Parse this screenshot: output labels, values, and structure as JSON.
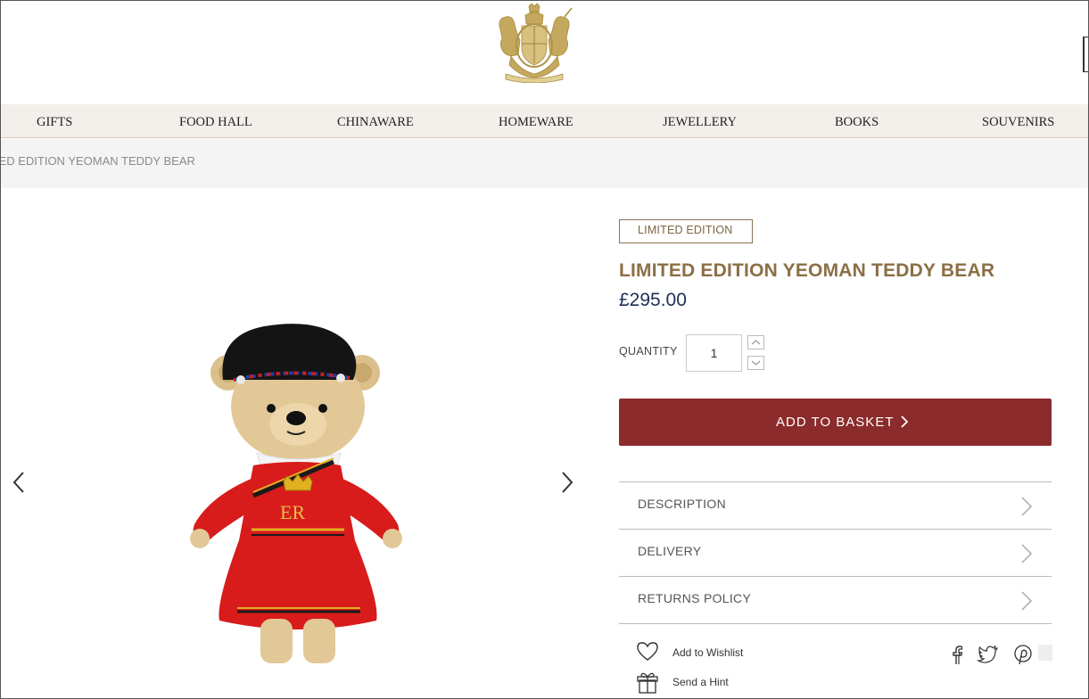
{
  "nav": {
    "items": [
      {
        "label": "GIFTS"
      },
      {
        "label": "FOOD HALL"
      },
      {
        "label": "CHINAWARE"
      },
      {
        "label": "HOMEWARE"
      },
      {
        "label": "JEWELLERY"
      },
      {
        "label": "BOOKS"
      },
      {
        "label": "SOUVENIRS"
      }
    ]
  },
  "breadcrumb": {
    "current": "ITED EDITION YEOMAN TEDDY BEAR"
  },
  "product": {
    "badge": "LIMITED EDITION",
    "title": "LIMITED EDITION YEOMAN TEDDY BEAR",
    "price": "£295.00",
    "quantity_label": "QUANTITY",
    "quantity_value": "1",
    "add_to_basket": "ADD TO BASKET",
    "image_monogram": "ER"
  },
  "accordion": [
    {
      "label": "DESCRIPTION"
    },
    {
      "label": "DELIVERY"
    },
    {
      "label": "RETURNS POLICY"
    }
  ],
  "actions": {
    "wishlist": "Add to Wishlist",
    "hint": "Send a Hint"
  },
  "icons": {
    "crest": "royal-crest-icon",
    "prev": "chevron-left-icon",
    "next": "chevron-right-icon",
    "wishlist": "heart-icon",
    "hint": "gift-icon",
    "social": [
      "facebook-icon",
      "twitter-icon",
      "pinterest-icon"
    ]
  },
  "colors": {
    "brand_gold": "#8b6f45",
    "price_navy": "#1f2d57",
    "basket_red": "#8b2b2b",
    "nav_bg": "#f3f0ec",
    "crest_gold": "#b89a4e"
  }
}
